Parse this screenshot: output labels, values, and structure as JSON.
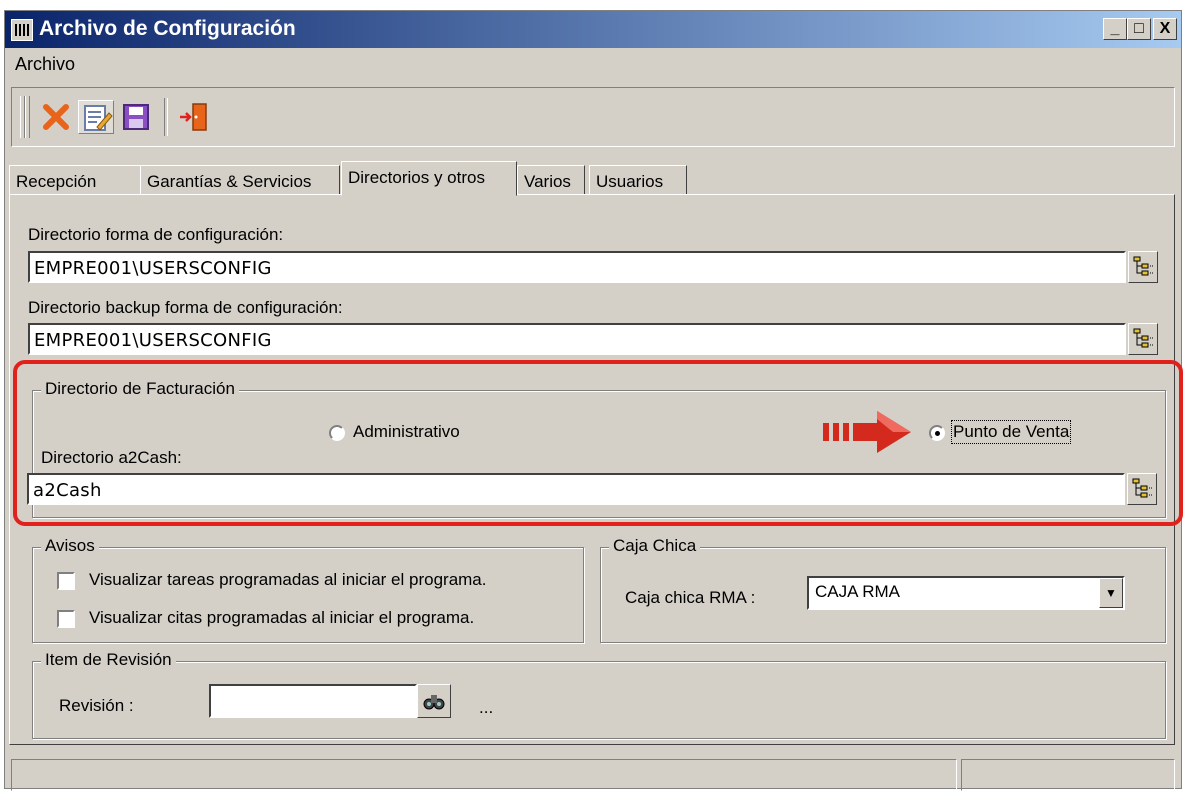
{
  "window": {
    "title": "Archivo de Configuración",
    "controls": [
      "_",
      "□",
      "X"
    ]
  },
  "menu": {
    "items": [
      "Archivo"
    ]
  },
  "toolbar": {
    "icons": [
      "delete-icon",
      "edit-icon",
      "save-icon",
      "exit-icon"
    ]
  },
  "tabs": [
    {
      "label": "Recepción",
      "active": false
    },
    {
      "label": "Garantías & Servicios",
      "active": false
    },
    {
      "label": "Directorios y otros",
      "active": true
    },
    {
      "label": "Varios",
      "active": false
    },
    {
      "label": "Usuarios",
      "active": false
    }
  ],
  "directories": {
    "config_label": "Directorio forma de configuración:",
    "config_value": "EMPRE001\\USERSCONFIG",
    "backup_label": "Directorio backup forma de configuración:",
    "backup_value": "EMPRE001\\USERSCONFIG"
  },
  "billing": {
    "legend": "Directorio de Facturación",
    "option_admin": "Administrativo",
    "option_pos": "Punto de Venta",
    "selected": "Punto de Venta",
    "a2cash_label": "Directorio a2Cash:",
    "a2cash_value": "a2Cash"
  },
  "avisos": {
    "legend": "Avisos",
    "tasks_label": "Visualizar tareas programadas al iniciar el programa.",
    "tasks_checked": false,
    "appointments_label": "Visualizar citas programadas al iniciar el programa.",
    "appointments_checked": false
  },
  "caja": {
    "legend": "Caja Chica",
    "label": "Caja chica RMA :",
    "value": "CAJA RMA"
  },
  "revision": {
    "legend": "Item de Revisión",
    "label": "Revisión :",
    "value": "",
    "ellipsis": "..."
  },
  "colors": {
    "highlight": "#e0211c",
    "titlebar_start": "#0a246a",
    "titlebar_end": "#a6caf0",
    "arrow": "#d42a1e"
  }
}
